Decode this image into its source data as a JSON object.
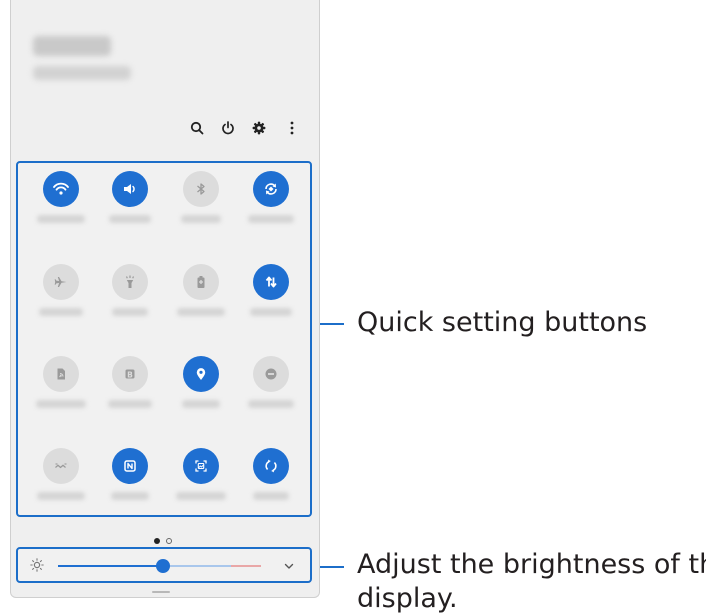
{
  "callouts": {
    "quick_settings": "Quick setting buttons",
    "brightness_line1": "Adjust the brightness of the",
    "brightness_line2": "display."
  },
  "colors": {
    "accent": "#1f6fd1",
    "callout_line": "#1c6ec9",
    "tile_off": "#dcdcdc"
  },
  "header_icons": [
    "search-icon",
    "power-icon",
    "settings-icon",
    "more-options-icon"
  ],
  "tiles": [
    {
      "icon": "wifi-icon",
      "state": "on"
    },
    {
      "icon": "sound-icon",
      "state": "on"
    },
    {
      "icon": "bluetooth-icon",
      "state": "off"
    },
    {
      "icon": "auto-rotate-icon",
      "state": "on"
    },
    {
      "icon": "airplane-mode-icon",
      "state": "off"
    },
    {
      "icon": "flashlight-icon",
      "state": "off"
    },
    {
      "icon": "power-saving-icon",
      "state": "off"
    },
    {
      "icon": "mobile-data-icon",
      "state": "on"
    },
    {
      "icon": "mobile-hotspot-icon",
      "state": "off"
    },
    {
      "icon": "bixby-routines-icon",
      "state": "off"
    },
    {
      "icon": "location-icon",
      "state": "on"
    },
    {
      "icon": "do-not-disturb-icon",
      "state": "off"
    },
    {
      "icon": "link-sharing-icon",
      "state": "off"
    },
    {
      "icon": "nfc-icon",
      "state": "on"
    },
    {
      "icon": "screen-recorder-icon",
      "state": "on"
    },
    {
      "icon": "sync-icon",
      "state": "on"
    }
  ],
  "pager": {
    "pages": 2,
    "current": 1
  },
  "brightness": {
    "level": 0.42,
    "icon": "sun-icon",
    "expand_icon": "chevron-down-icon"
  }
}
